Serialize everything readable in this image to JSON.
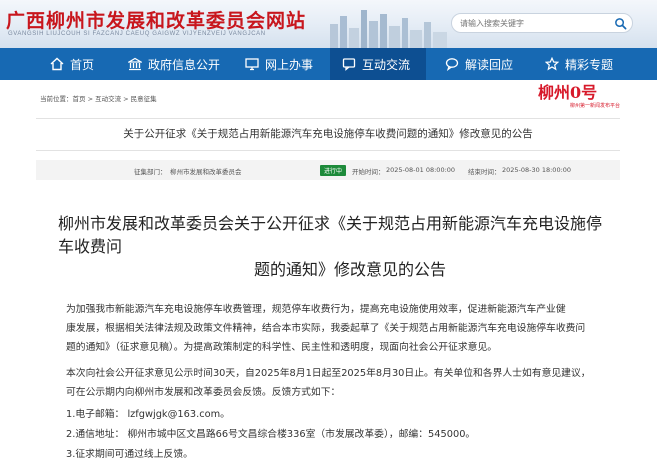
{
  "header": {
    "site_title": "广西柳州市发展和改革委员会网站",
    "site_subtitle": "GVANGSIH LIUJCOUH SI FAZCANJ CAEUQ GAIGWZ VIJYENZVEIJ VANGJCAN",
    "search_placeholder": "请输入搜索关键字"
  },
  "nav": {
    "items": [
      {
        "label": "首页",
        "icon": "home-icon"
      },
      {
        "label": "政府信息公开",
        "icon": "building-icon"
      },
      {
        "label": "网上办事",
        "icon": "monitor-icon"
      },
      {
        "label": "互动交流",
        "icon": "chat-icon",
        "active": true
      },
      {
        "label": "解读回应",
        "icon": "speech-icon"
      },
      {
        "label": "精彩专题",
        "icon": "star-icon"
      }
    ]
  },
  "breadcrumb": "当前位置：首页 > 互动交流 > 民意征集",
  "logo": {
    "main": "柳州0号",
    "sub": "柳州第一新闻发布平台"
  },
  "notice_title": "关于公开征求《关于规范占用新能源汽车充电设施停车收费问题的通知》修改意见的公告",
  "meta": {
    "dept_label": "征集部门：",
    "dept_value": "柳州市发展和改革委员会",
    "status": "进行中",
    "start_label": "开始时间：",
    "start_value": "2025-08-01 08:00:00",
    "end_label": "结束时间：",
    "end_value": "2025-08-30 18:00:00"
  },
  "article": {
    "title_line1": "柳州市发展和改革委员会关于公开征求《关于规范占用新能源汽车充电设施停车收费问",
    "title_line2": "题的通知》修改意见的公告",
    "p1_l1": "为加强我市新能源汽车充电设施停车收费管理，规范停车收费行为，提高充电设施使用效率，促进新能源汽车产业健",
    "p1_l2": "康发展，根据相关法律法规及政策文件精神，结合本市实际，我委起草了《关于规范占用新能源汽车充电设施停车收费问",
    "p1_l3": "题的通知》（征求意见稿）。为提高政策制定的科学性、民主性和透明度，现面向社会公开征求意见。",
    "p2_l1": "本次向社会公开征求意见公示时间30天，自2025年8月1日起至2025年8月30日止。有关单位和各界人士如有意见建议，",
    "p2_l2": "可在公示期内向柳州市发展和改革委员会反馈。反馈方式如下：",
    "item1": "1.电子邮箱：  lzfgwjgk@163.com。",
    "item2": "2.通信地址：  柳州市城中区文昌路66号文昌综合楼336室（市发展改革委），邮编：545000。",
    "item3": "3.征求期间可通过线上反馈。"
  },
  "colors": {
    "brand_red": "#c8161d",
    "nav_blue": "#1769b3",
    "nav_active": "#0d4f92",
    "status_green": "#1d8a3a"
  }
}
